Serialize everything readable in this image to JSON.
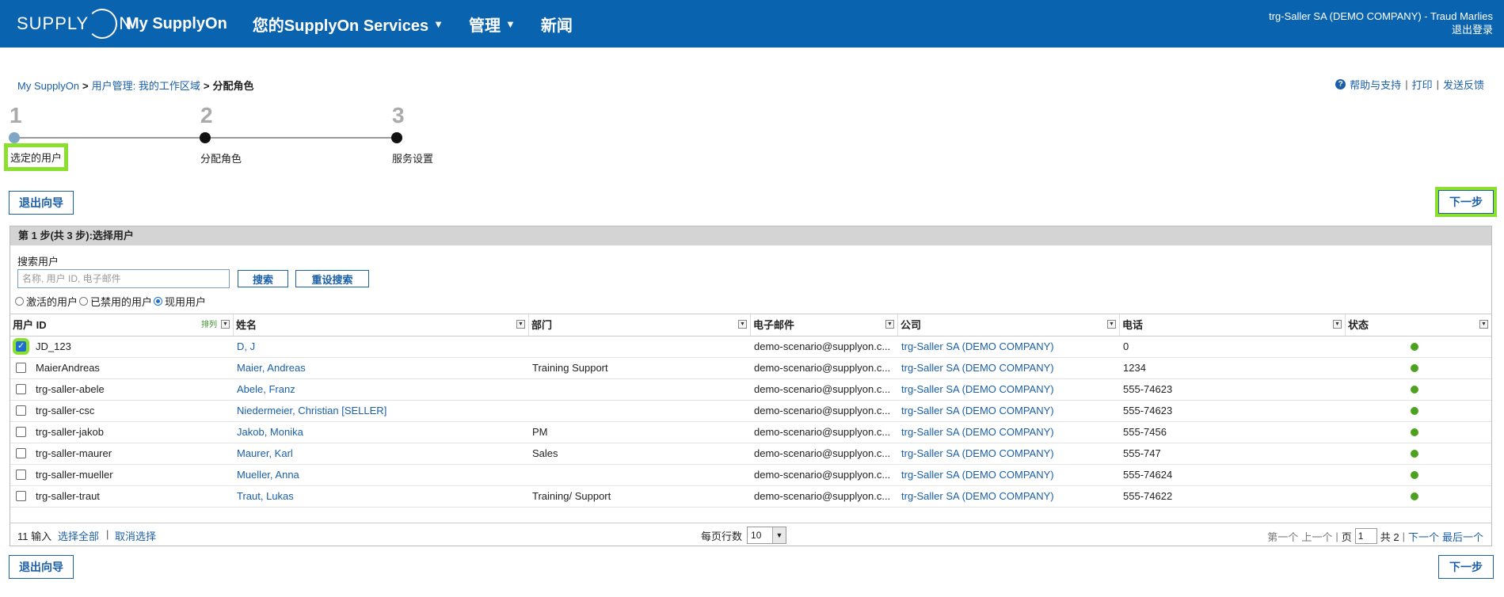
{
  "header": {
    "logo_text": "SUPPLY",
    "logo_suffix": "N",
    "nav": [
      {
        "label": "My SupplyOn",
        "has_menu": false
      },
      {
        "label": "您的SupplyOn Services",
        "has_menu": true
      },
      {
        "label": "管理",
        "has_menu": true
      },
      {
        "label": "新闻",
        "has_menu": false
      }
    ],
    "caret": "▼",
    "company_user": "trg-Saller SA (DEMO COMPANY) - Traud Marlies",
    "logout": "退出登录"
  },
  "breadcrumb": {
    "items": [
      "My SupplyOn",
      "用户管理: 我的工作区域"
    ],
    "current": "分配角色",
    "separator": ">"
  },
  "helpbar": {
    "help_icon": "?",
    "help": "帮助与支持",
    "print": "打印",
    "feedback": "发送反馈",
    "divider": "|"
  },
  "steps": [
    {
      "number": "1",
      "label": "选定的用户",
      "active": true
    },
    {
      "number": "2",
      "label": "分配角色",
      "active": false
    },
    {
      "number": "3",
      "label": "服务设置",
      "active": false
    }
  ],
  "buttons": {
    "exit_wizard": "退出向导",
    "next": "下一步",
    "search": "搜索",
    "reset_search": "重设搜索"
  },
  "panel": {
    "title": "第 1 步(共 3 步):选择用户",
    "search_label": "搜索用户",
    "search_placeholder": "名称, 用户 ID, 电子邮件",
    "radios": [
      {
        "label": "激活的用户",
        "checked": false
      },
      {
        "label": "已禁用的用户",
        "checked": false
      },
      {
        "label": "现用用户",
        "checked": true
      }
    ]
  },
  "table": {
    "columns": [
      "用户 ID",
      "姓名",
      "部门",
      "电子邮件",
      "公司",
      "电话",
      "状态"
    ],
    "sort_label": "排列",
    "filter_glyph": "▼",
    "rows": [
      {
        "checked": true,
        "id": "JD_123",
        "name": "D, J",
        "dept": "",
        "email": "demo-scenario@supplyon.c...",
        "company": "trg-Saller SA (DEMO COMPANY)",
        "phone": "0"
      },
      {
        "checked": false,
        "id": "MaierAndreas",
        "name": "Maier, Andreas",
        "dept": "Training Support",
        "email": "demo-scenario@supplyon.c...",
        "company": "trg-Saller SA (DEMO COMPANY)",
        "phone": "1234"
      },
      {
        "checked": false,
        "id": "trg-saller-abele",
        "name": "Abele, Franz",
        "dept": "",
        "email": "demo-scenario@supplyon.c...",
        "company": "trg-Saller SA (DEMO COMPANY)",
        "phone": "555-74623"
      },
      {
        "checked": false,
        "id": "trg-saller-csc",
        "name": "Niedermeier, Christian [SELLER]",
        "dept": "",
        "email": "demo-scenario@supplyon.c...",
        "company": "trg-Saller SA (DEMO COMPANY)",
        "phone": "555-74623"
      },
      {
        "checked": false,
        "id": "trg-saller-jakob",
        "name": "Jakob, Monika",
        "dept": "PM",
        "email": "demo-scenario@supplyon.c...",
        "company": "trg-Saller SA (DEMO COMPANY)",
        "phone": "555-7456"
      },
      {
        "checked": false,
        "id": "trg-saller-maurer",
        "name": "Maurer, Karl",
        "dept": "Sales",
        "email": "demo-scenario@supplyon.c...",
        "company": "trg-Saller SA (DEMO COMPANY)",
        "phone": "555-747"
      },
      {
        "checked": false,
        "id": "trg-saller-mueller",
        "name": "Mueller, Anna",
        "dept": "",
        "email": "demo-scenario@supplyon.c...",
        "company": "trg-Saller SA (DEMO COMPANY)",
        "phone": "555-74624"
      },
      {
        "checked": false,
        "id": "trg-saller-traut",
        "name": "Traut, Lukas",
        "dept": "Training/ Support",
        "email": "demo-scenario@supplyon.c...",
        "company": "trg-Saller SA (DEMO COMPANY)",
        "phone": "555-74622"
      }
    ]
  },
  "footer": {
    "count_text": "11 输入",
    "select_all": "选择全部",
    "deselect": "取消选择",
    "divider": "|",
    "rows_per_page_label": "每页行数",
    "rows_per_page": "10",
    "select_glyph": "▼",
    "first": "第一个",
    "prev": "上一个",
    "page_label": "页",
    "page_value": "1",
    "total": "共 2",
    "next": "下一个",
    "last": "最后一个"
  },
  "colors": {
    "header_bg": "#0a63ae",
    "link": "#1a5fa8",
    "highlight": "#8be02f",
    "status_active": "#4ca11f"
  }
}
